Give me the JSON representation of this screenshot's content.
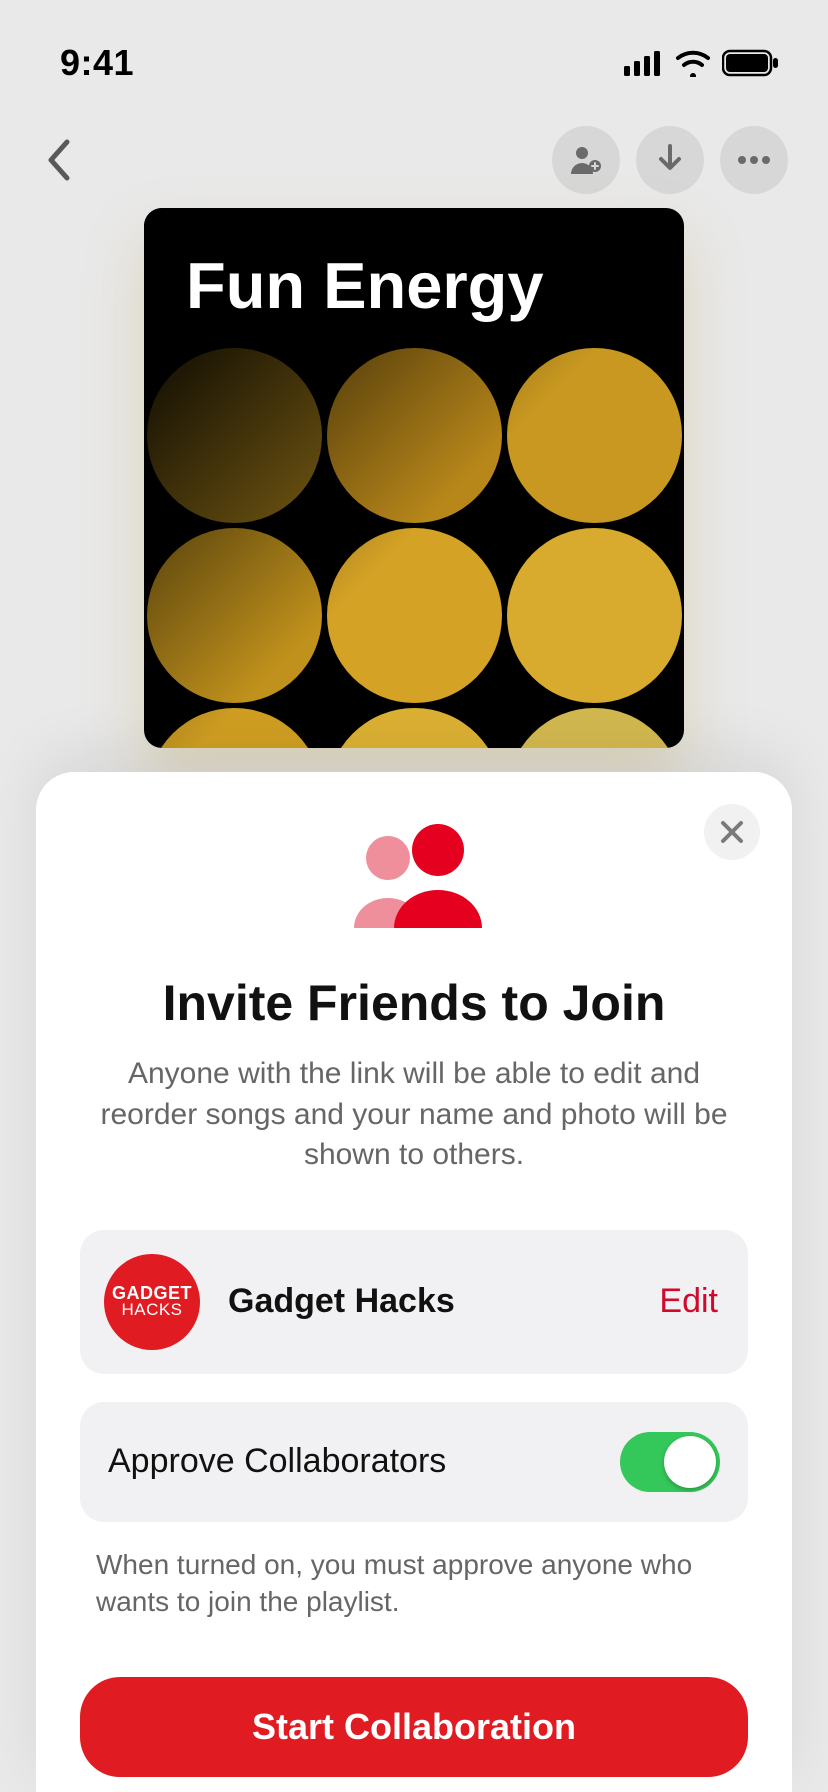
{
  "status": {
    "time": "9:41"
  },
  "playlist": {
    "title": "Fun Energy"
  },
  "sheet": {
    "title": "Invite Friends to Join",
    "description": "Anyone with the link will be able to edit and reorder songs and your name and photo will be shown to others.",
    "profile": {
      "name": "Gadget Hacks",
      "avatar_line1": "GADGET",
      "avatar_line2": "HACKS",
      "edit_label": "Edit"
    },
    "approve": {
      "label": "Approve Collaborators",
      "description": "When turned on, you must approve anyone who wants to join the playlist.",
      "enabled": true
    },
    "cta_label": "Start Collaboration"
  }
}
